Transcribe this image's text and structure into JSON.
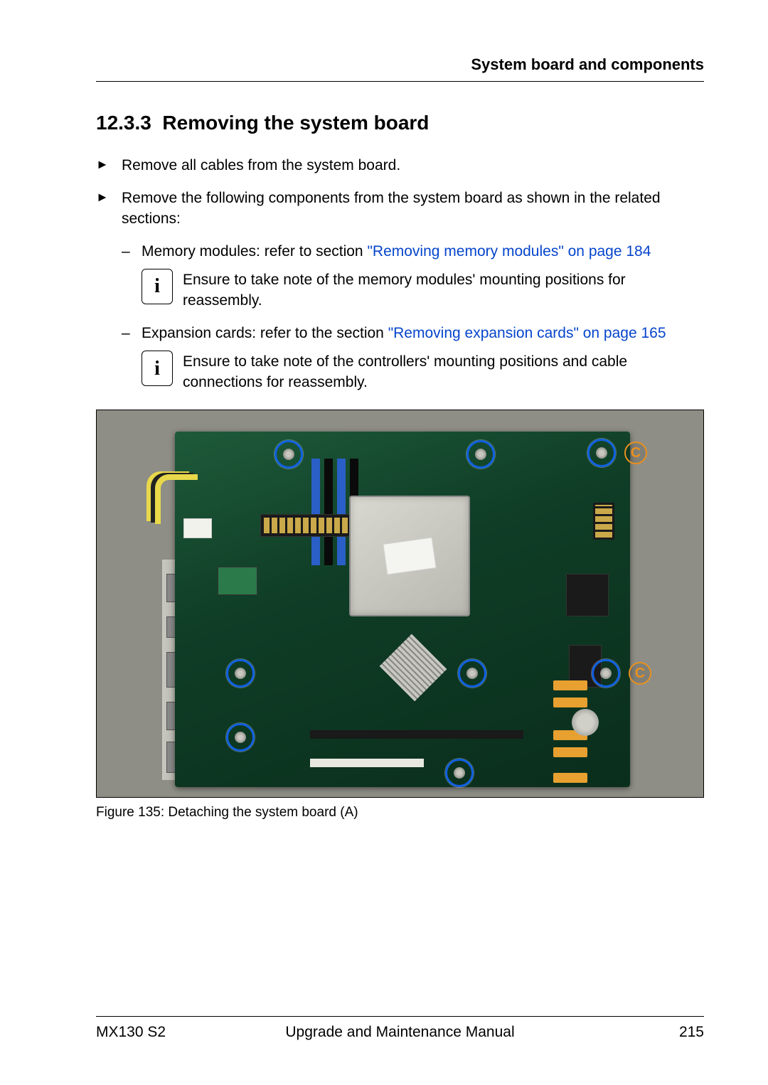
{
  "header": {
    "title": "System board and components"
  },
  "section": {
    "number": "12.3.3",
    "title": "Removing the system board"
  },
  "steps": [
    {
      "text": "Remove all cables from the system board."
    },
    {
      "text": "Remove the following components from the system board as shown in the related sections:"
    }
  ],
  "sub_items": [
    {
      "prefix": "Memory modules: refer to section ",
      "link": "\"Removing memory modules\" on page 184",
      "note": "Ensure to take note of the memory modules' mounting positions for reassembly."
    },
    {
      "prefix": "Expansion cards: refer to the section ",
      "link": "\"Removing expansion cards\" on page 165",
      "note": "Ensure to take note of the controllers' mounting positions and cable connections for reassembly."
    }
  ],
  "figure": {
    "caption": "Figure 135: Detaching the system board (A)",
    "callout_label": "C"
  },
  "footer": {
    "left": "MX130 S2",
    "center": "Upgrade and Maintenance Manual",
    "right": "215"
  }
}
